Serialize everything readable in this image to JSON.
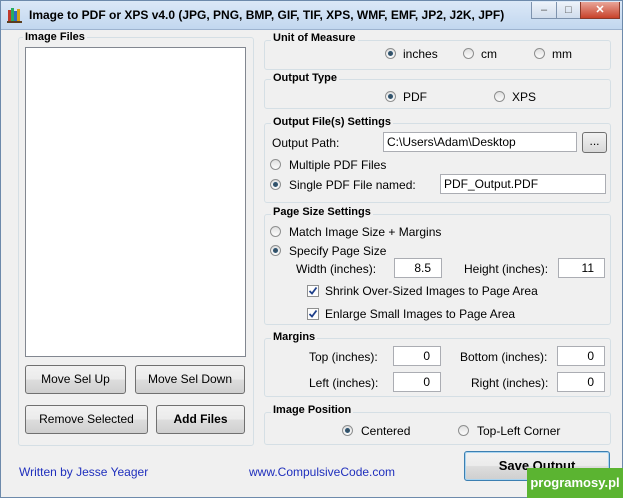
{
  "window": {
    "title": "Image to PDF or XPS  v4.0  (JPG, PNG, BMP, GIF, TIF, XPS, WMF, EMF, JP2, J2K, JPF)",
    "app_icon": "books-icon",
    "controls": {
      "minimize": "–",
      "maximize": "□",
      "close": "✕"
    }
  },
  "image_files": {
    "title": "Image Files",
    "items": [],
    "buttons": {
      "move_up": "Move Sel Up",
      "move_down": "Move Sel Down",
      "remove": "Remove Selected",
      "add": "Add Files"
    }
  },
  "unit_of_measure": {
    "title": "Unit of Measure",
    "options": [
      "inches",
      "cm",
      "mm"
    ],
    "selected": "inches"
  },
  "output_type": {
    "title": "Output Type",
    "options": [
      "PDF",
      "XPS"
    ],
    "selected": "PDF"
  },
  "output_files": {
    "title": "Output File(s) Settings",
    "path_label": "Output Path:",
    "path_value": "C:\\Users\\Adam\\Desktop",
    "browse_label": "...",
    "multiple_label": "Multiple PDF Files",
    "single_label": "Single PDF File named:",
    "single_value": "PDF_Output.PDF",
    "selected": "single"
  },
  "page_size": {
    "title": "Page Size Settings",
    "match_label": "Match Image Size + Margins",
    "specify_label": "Specify Page Size",
    "selected": "specify",
    "width_label": "Width (inches):",
    "width_value": "8.5",
    "height_label": "Height (inches):",
    "height_value": "11",
    "shrink_label": "Shrink Over-Sized Images to Page Area",
    "shrink_checked": true,
    "enlarge_label": "Enlarge Small Images to Page Area",
    "enlarge_checked": true
  },
  "margins": {
    "title": "Margins",
    "top_label": "Top (inches):",
    "top_value": "0",
    "bottom_label": "Bottom (inches):",
    "bottom_value": "0",
    "left_label": "Left (inches):",
    "left_value": "0",
    "right_label": "Right (inches):",
    "right_value": "0"
  },
  "image_position": {
    "title": "Image Position",
    "options": [
      "Centered",
      "Top-Left Corner"
    ],
    "selected": "Centered"
  },
  "footer": {
    "author": "Written by Jesse Yeager",
    "website": "www.CompulsiveCode.com",
    "save_label": "Save Output",
    "link_color": "#1f2fbd"
  },
  "watermark": {
    "text": "programosy.pl",
    "color": "#5bb431"
  }
}
